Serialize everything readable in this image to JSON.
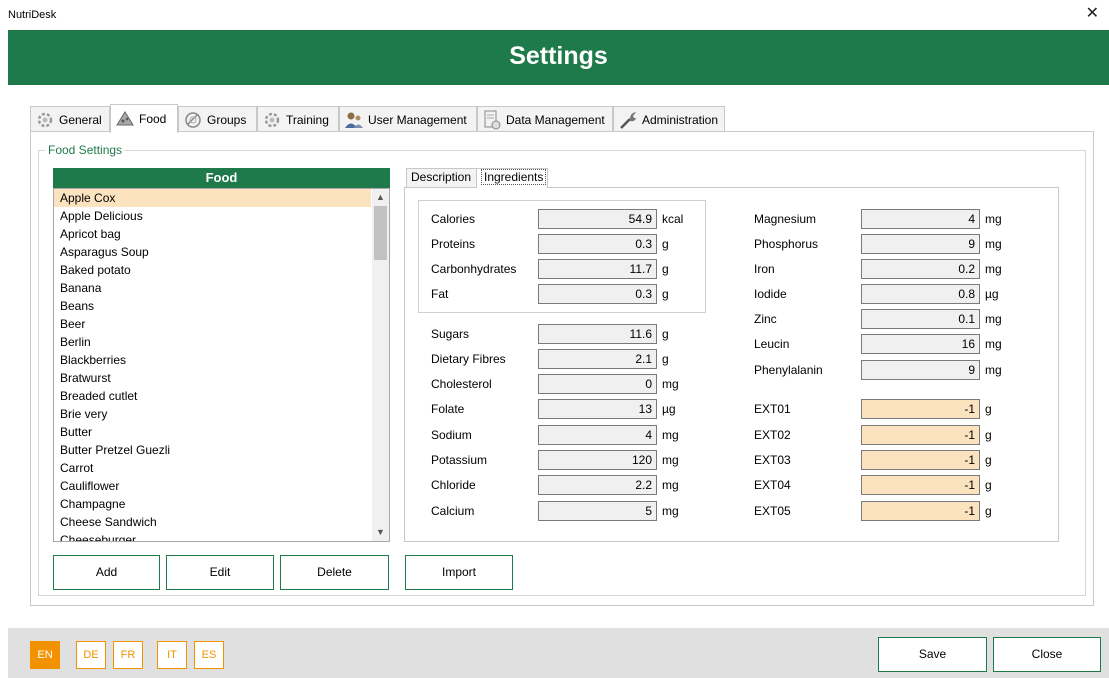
{
  "window": {
    "title": "NutriDesk",
    "close_glyph": "✕"
  },
  "header": {
    "title": "Settings"
  },
  "tabs": [
    {
      "label": "General",
      "icon": "gear-icon"
    },
    {
      "label": "Food",
      "icon": "food-icon"
    },
    {
      "label": "Groups",
      "icon": "groups-icon"
    },
    {
      "label": "Training",
      "icon": "training-icon"
    },
    {
      "label": "User Management",
      "icon": "users-icon"
    },
    {
      "label": "Data Management",
      "icon": "data-icon"
    },
    {
      "label": "Administration",
      "icon": "wrench-icon"
    }
  ],
  "active_tab": "Food",
  "food_settings": {
    "legend": "Food Settings",
    "list_header": "Food",
    "selected": "Apple Cox",
    "items": [
      "Apple Cox",
      "Apple Delicious",
      "Apricot bag",
      "Asparagus Soup",
      "Baked potato",
      "Banana",
      "Beans",
      "Beer",
      "Berlin",
      "Blackberries",
      "Bratwurst",
      "Breaded cutlet",
      "Brie very",
      "Butter",
      "Butter Pretzel Guezli",
      "Carrot",
      "Cauliflower",
      "Champagne",
      "Cheese Sandwich",
      "Cheeseburger"
    ],
    "buttons": {
      "add": "Add",
      "edit": "Edit",
      "delete": "Delete",
      "import": "Import"
    }
  },
  "detail_tabs": {
    "description": "Description",
    "ingredients": "Ingredients",
    "active": "Ingredients"
  },
  "macros": [
    {
      "label": "Calories",
      "value": "54.9",
      "unit": "kcal"
    },
    {
      "label": "Proteins",
      "value": "0.3",
      "unit": "g"
    },
    {
      "label": "Carbonhydrates",
      "value": "11.7",
      "unit": "g"
    },
    {
      "label": "Fat",
      "value": "0.3",
      "unit": "g"
    }
  ],
  "nutrients_left": [
    {
      "label": "Sugars",
      "value": "11.6",
      "unit": "g"
    },
    {
      "label": "Dietary Fibres",
      "value": "2.1",
      "unit": "g"
    },
    {
      "label": "Cholesterol",
      "value": "0",
      "unit": "mg"
    },
    {
      "label": "Folate",
      "value": "13",
      "unit": "µg"
    },
    {
      "label": "Sodium",
      "value": "4",
      "unit": "mg"
    },
    {
      "label": "Potassium",
      "value": "120",
      "unit": "mg"
    },
    {
      "label": "Chloride",
      "value": "2.2",
      "unit": "mg"
    },
    {
      "label": "Calcium",
      "value": "5",
      "unit": "mg"
    }
  ],
  "nutrients_right": [
    {
      "label": "Magnesium",
      "value": "4",
      "unit": "mg"
    },
    {
      "label": "Phosphorus",
      "value": "9",
      "unit": "mg"
    },
    {
      "label": "Iron",
      "value": "0.2",
      "unit": "mg"
    },
    {
      "label": "Iodide",
      "value": "0.8",
      "unit": "µg"
    },
    {
      "label": "Zinc",
      "value": "0.1",
      "unit": "mg"
    },
    {
      "label": "Leucin",
      "value": "16",
      "unit": "mg"
    },
    {
      "label": "Phenylalanin",
      "value": "9",
      "unit": "mg"
    }
  ],
  "extensions": [
    {
      "label": "EXT01",
      "value": "-1",
      "unit": "g"
    },
    {
      "label": "EXT02",
      "value": "-1",
      "unit": "g"
    },
    {
      "label": "EXT03",
      "value": "-1",
      "unit": "g"
    },
    {
      "label": "EXT04",
      "value": "-1",
      "unit": "g"
    },
    {
      "label": "EXT05",
      "value": "-1",
      "unit": "g"
    }
  ],
  "languages": [
    "EN",
    "DE",
    "FR",
    "IT",
    "ES"
  ],
  "active_language": "EN",
  "footer": {
    "save": "Save",
    "close": "Close"
  },
  "colors": {
    "brand_green": "#1e7a4b",
    "accent_orange": "#f39200",
    "highlight_peach": "#fbe3c0"
  }
}
